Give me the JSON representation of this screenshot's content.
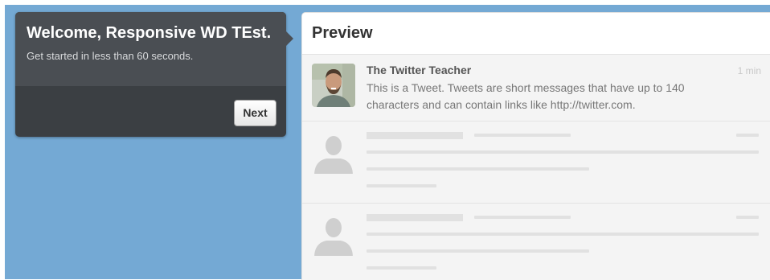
{
  "welcome": {
    "title": "Welcome, Responsive WD TEst.",
    "subtitle": "Get started in less than 60 seconds.",
    "next_label": "Next"
  },
  "preview": {
    "title": "Preview",
    "tweet": {
      "author": "The Twitter Teacher",
      "time": "1 min",
      "text": "This is a Tweet. Tweets are short messages that have up to 140 characters and can contain links like http://twitter.com."
    },
    "placeholder_count": 2
  },
  "colors": {
    "background": "#74a9d4",
    "welcome_card": "#3b3f43",
    "preview_bg": "#f4f4f4"
  }
}
